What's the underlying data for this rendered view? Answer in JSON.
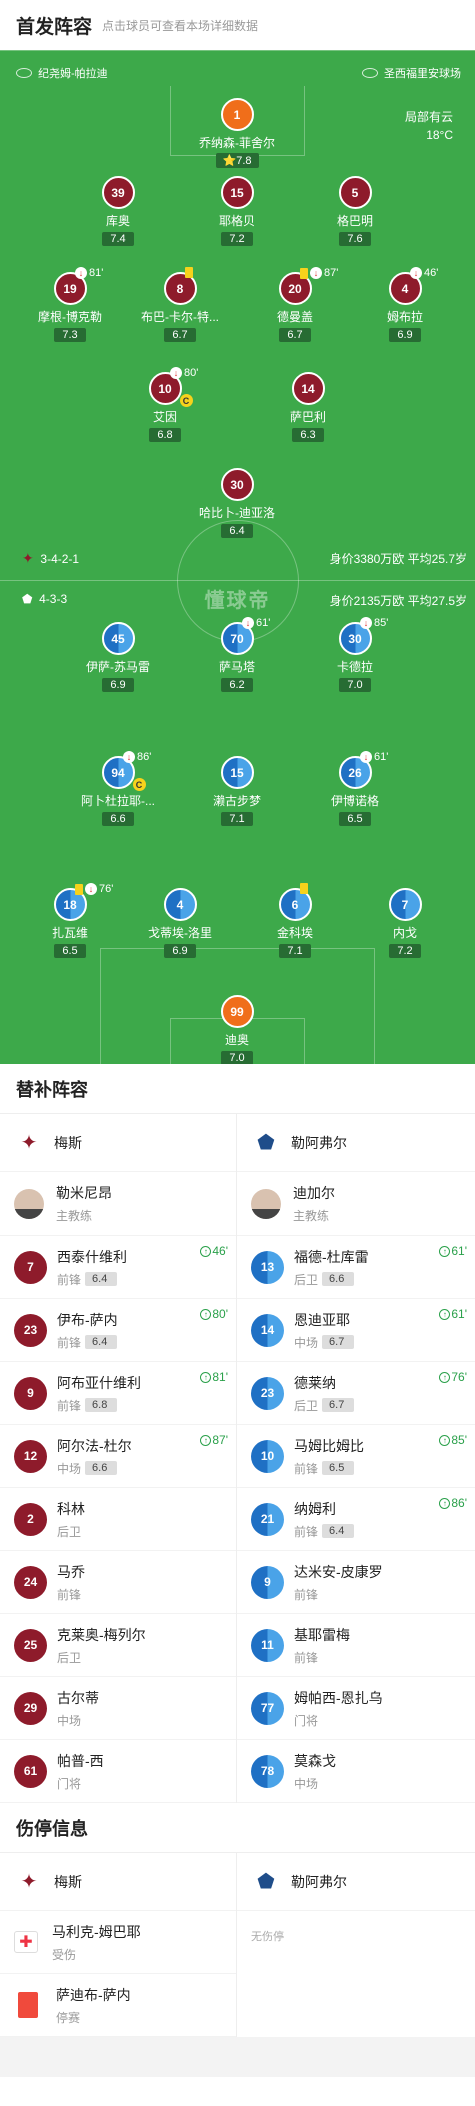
{
  "header": {
    "title": "首发阵容",
    "subtitle": "点击球员可查看本场详细数据"
  },
  "pitch": {
    "home_team": "纪尧姆-帕拉迪",
    "away_team": "圣西福里安球场",
    "weather": "局部有云",
    "temp": "18°C",
    "home_form": "3-4-2-1",
    "home_value": "身价3380万欧 平均25.7岁",
    "away_form": "4-3-3",
    "away_value": "身价2135万欧 平均27.5岁",
    "watermark": "懂球帝",
    "home_gk": {
      "num": "1",
      "name": "乔纳森-菲舍尔",
      "rating": "7.8"
    },
    "home_def": [
      {
        "num": "39",
        "name": "库奥",
        "rating": "7.4"
      },
      {
        "num": "15",
        "name": "耶格贝",
        "rating": "7.2"
      },
      {
        "num": "5",
        "name": "格巴明",
        "rating": "7.6"
      }
    ],
    "home_mid": [
      {
        "num": "19",
        "name": "摩根-博克勒",
        "rating": "7.3",
        "min": "81'"
      },
      {
        "num": "8",
        "name": "布巴-卡尔-特...",
        "rating": "6.7"
      },
      {
        "num": "20",
        "name": "德曼盖",
        "rating": "6.7",
        "min": "87'"
      },
      {
        "num": "4",
        "name": "姆布拉",
        "rating": "6.9",
        "min": "46'"
      }
    ],
    "home_am": [
      {
        "num": "10",
        "name": "艾因",
        "rating": "6.8",
        "min": "80'"
      },
      {
        "num": "14",
        "name": "萨巴利",
        "rating": "6.3"
      }
    ],
    "home_fw": {
      "num": "30",
      "name": "哈比卜-迪亚洛",
      "rating": "6.4"
    },
    "away_fw": [
      {
        "num": "45",
        "name": "伊萨-苏马雷",
        "rating": "6.9"
      },
      {
        "num": "70",
        "name": "萨马塔",
        "rating": "6.2",
        "min": "61'"
      },
      {
        "num": "30",
        "name": "卡德拉",
        "rating": "7.0",
        "min": "85'"
      }
    ],
    "away_mid": [
      {
        "num": "94",
        "name": "阿卜杜拉耶-...",
        "rating": "6.6",
        "min": "86'"
      },
      {
        "num": "15",
        "name": "濑古步梦",
        "rating": "7.1"
      },
      {
        "num": "26",
        "name": "伊博诺格",
        "rating": "6.5",
        "min": "61'"
      }
    ],
    "away_def": [
      {
        "num": "18",
        "name": "扎瓦维",
        "rating": "6.5",
        "min": "76'"
      },
      {
        "num": "4",
        "name": "戈蒂埃-洛里",
        "rating": "6.9"
      },
      {
        "num": "6",
        "name": "金科埃",
        "rating": "7.1"
      },
      {
        "num": "7",
        "name": "内戈",
        "rating": "7.2"
      }
    ],
    "away_gk": {
      "num": "99",
      "name": "迪奥",
      "rating": "7.0"
    },
    "captain": "C"
  },
  "subs": {
    "title": "替补阵容",
    "home": {
      "team": "梅斯",
      "coach": "勒米尼昂",
      "coach_role": "主教练",
      "players": [
        {
          "num": "7",
          "name": "西泰什维利",
          "pos": "前锋",
          "rating": "6.4",
          "min": "46'"
        },
        {
          "num": "23",
          "name": "伊布-萨内",
          "pos": "前锋",
          "rating": "6.4",
          "min": "80'"
        },
        {
          "num": "9",
          "name": "阿布亚什维利",
          "pos": "前锋",
          "rating": "6.8",
          "min": "81'"
        },
        {
          "num": "12",
          "name": "阿尔法-杜尔",
          "pos": "中场",
          "rating": "6.6",
          "min": "87'"
        },
        {
          "num": "2",
          "name": "科林",
          "pos": "后卫"
        },
        {
          "num": "24",
          "name": "马乔",
          "pos": "前锋"
        },
        {
          "num": "25",
          "name": "克莱奥-梅列尔",
          "pos": "后卫"
        },
        {
          "num": "29",
          "name": "古尔蒂",
          "pos": "中场"
        },
        {
          "num": "61",
          "name": "帕普-西",
          "pos": "门将"
        }
      ]
    },
    "away": {
      "team": "勒阿弗尔",
      "coach": "迪加尔",
      "coach_role": "主教练",
      "players": [
        {
          "num": "13",
          "name": "福德-杜库雷",
          "pos": "后卫",
          "rating": "6.6",
          "min": "61'"
        },
        {
          "num": "14",
          "name": "恩迪亚耶",
          "pos": "中场",
          "rating": "6.7",
          "min": "61'"
        },
        {
          "num": "23",
          "name": "德莱纳",
          "pos": "后卫",
          "rating": "6.7",
          "min": "76'"
        },
        {
          "num": "10",
          "name": "马姆比姆比",
          "pos": "前锋",
          "rating": "6.5",
          "min": "85'"
        },
        {
          "num": "21",
          "name": "纳姆利",
          "pos": "前锋",
          "rating": "6.4",
          "min": "86'"
        },
        {
          "num": "9",
          "name": "达米安-皮康罗",
          "pos": "前锋"
        },
        {
          "num": "11",
          "name": "基耶雷梅",
          "pos": "前锋"
        },
        {
          "num": "77",
          "name": "姆帕西-恩扎乌",
          "pos": "门将"
        },
        {
          "num": "78",
          "name": "莫森戈",
          "pos": "中场"
        }
      ]
    }
  },
  "injury": {
    "title": "伤停信息",
    "home_team": "梅斯",
    "away_team": "勒阿弗尔",
    "home": [
      {
        "name": "马利克-姆巴耶",
        "status": "受伤"
      },
      {
        "name": "萨迪布-萨内",
        "status": "停赛"
      }
    ],
    "away_none": "无伤停"
  },
  "colors": {
    "pitch": "#3da94a",
    "home": "#8e1b2b",
    "away": "#1f70c4",
    "gk": "#f06e1a",
    "yellow": "#f7d21c"
  }
}
